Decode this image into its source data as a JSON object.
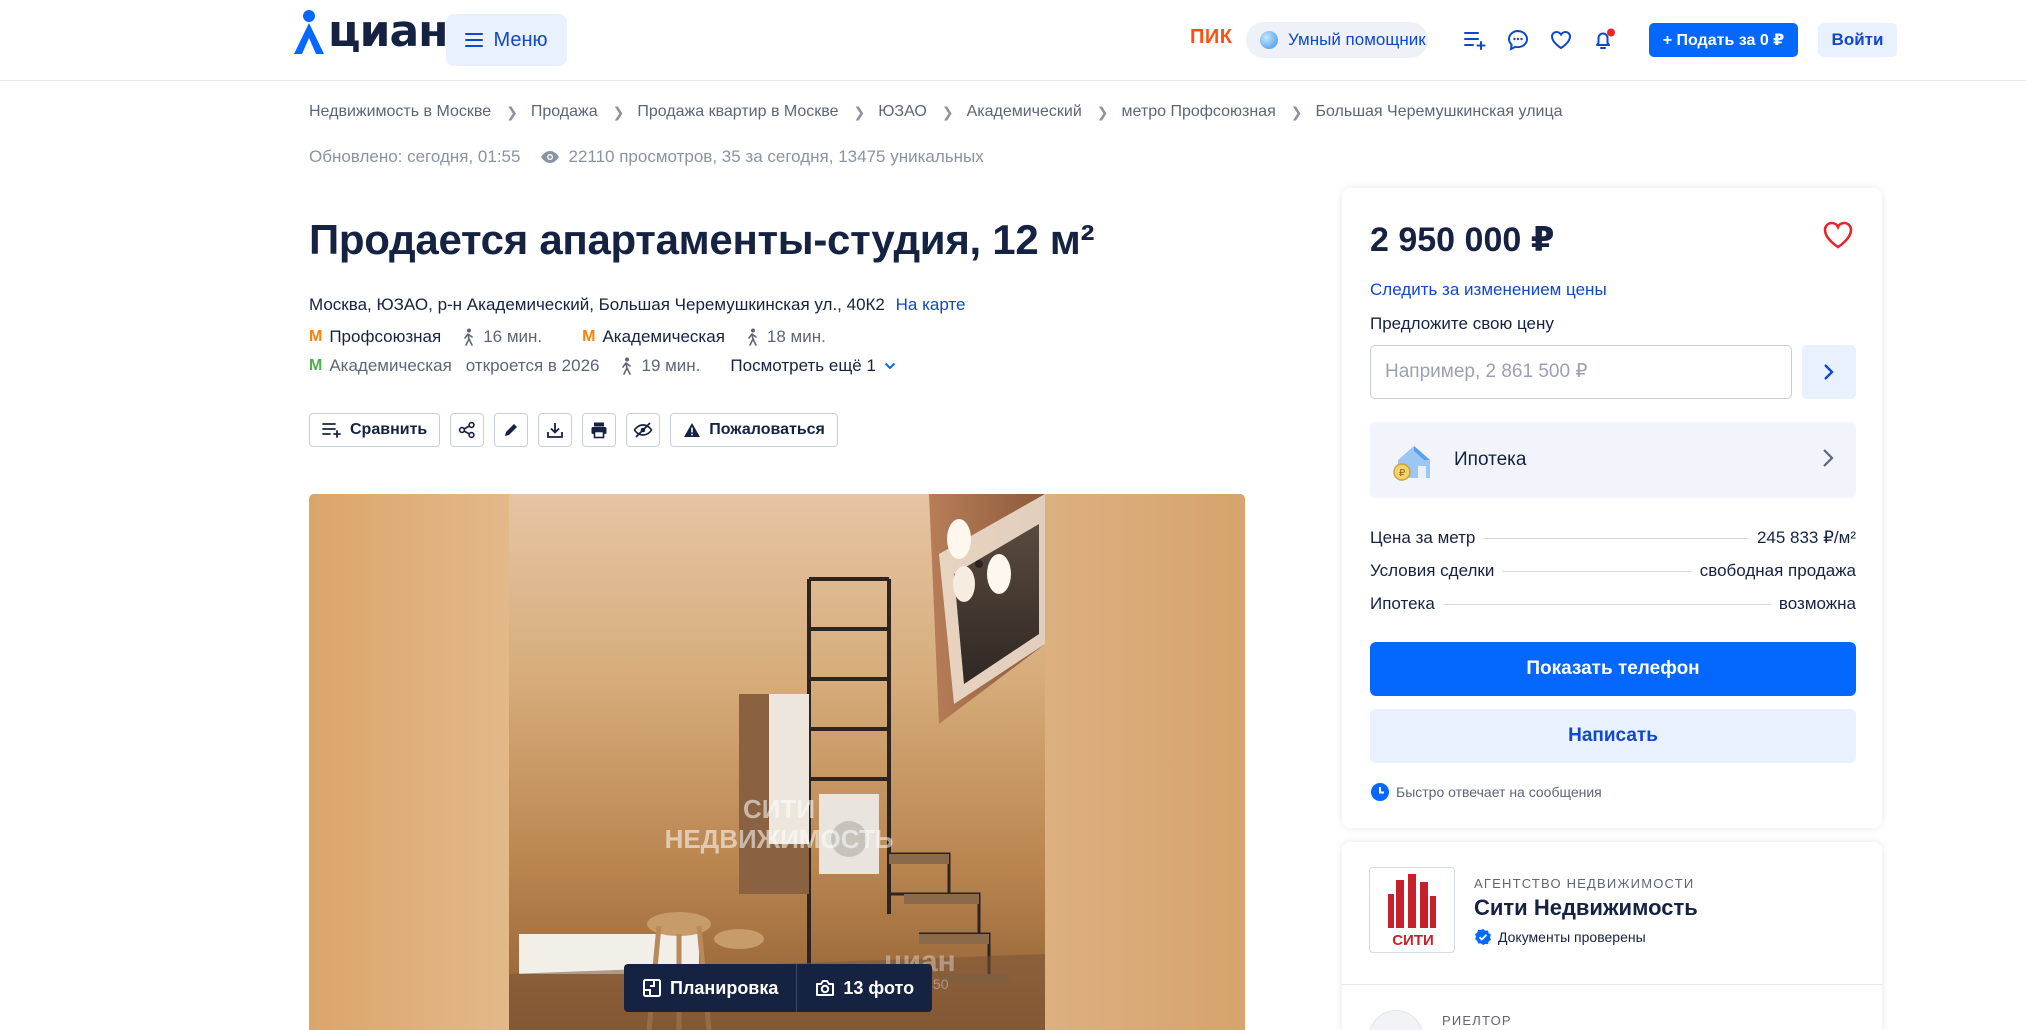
{
  "header": {
    "logo_text": "циан",
    "menu_label": "Меню",
    "pik_label": "ПИК",
    "assistant_label": "Умный помощник",
    "post_label": "+ Подать за 0 ₽",
    "login_label": "Войти"
  },
  "breadcrumbs": [
    "Недвижимость в Москве",
    "Продажа",
    "Продажа квартир в Москве",
    "ЮЗАО",
    "Академический",
    "метро Профсоюзная",
    "Большая Черемушкинская улица"
  ],
  "meta": {
    "updated": "Обновлено: сегодня, 01:55",
    "views": "22110 просмотров, 35 за сегодня, 13475 уникальных"
  },
  "listing": {
    "title": "Продается апартаменты-студия, 12 м²",
    "address": "Москва, ЮЗАО, р-н Академический, Большая Черемушкинская ул., 40К2",
    "map_link": "На карте",
    "metro": [
      {
        "name": "Профсоюзная",
        "time": "16 мин.",
        "color": "#ff8103"
      },
      {
        "name": "Академическая",
        "time": "18 мин.",
        "color": "#ff8103"
      }
    ],
    "metro_future": {
      "name": "Академическая",
      "note": "откроется в 2026",
      "time": "19 мин.",
      "color": "#4caf50"
    },
    "more_link": "Посмотреть ещё 1"
  },
  "toolbar": {
    "compare_label": "Сравнить",
    "complain_label": "Пожаловаться"
  },
  "gallery": {
    "watermark_line1": "СИТИ",
    "watermark_line2": "НЕДВИЖИМОСТЬ",
    "watermark_brand": "циан",
    "watermark_id": "4922450",
    "plan_label": "Планировка",
    "photos_label": "13 фото"
  },
  "offer": {
    "price": "2 950 000 ₽",
    "track_price": "Следить за изменением цены",
    "suggest_label": "Предложите свою цену",
    "suggest_placeholder": "Например, 2 861 500 ₽",
    "mortgage_label": "Ипотека",
    "facts": [
      {
        "label": "Цена за метр",
        "value": "245 833 ₽/м²"
      },
      {
        "label": "Условия сделки",
        "value": "свободная продажа"
      },
      {
        "label": "Ипотека",
        "value": "возможна"
      }
    ],
    "call_label": "Показать телефон",
    "write_label": "Написать",
    "fast_reply": "Быстро отвечает на сообщения"
  },
  "agency": {
    "kind": "АГЕНТСТВО НЕДВИЖИМОСТИ",
    "name": "Сити Недвижимость",
    "verified": "Документы проверены",
    "logo_text": "СИТИ",
    "realtor_kind": "РИЕЛТОР"
  },
  "colors": {
    "primary": "#0468ff",
    "link": "#0f48c8",
    "text": "#152242",
    "pik": "#ff4f12",
    "favorite": "#e8242c"
  }
}
